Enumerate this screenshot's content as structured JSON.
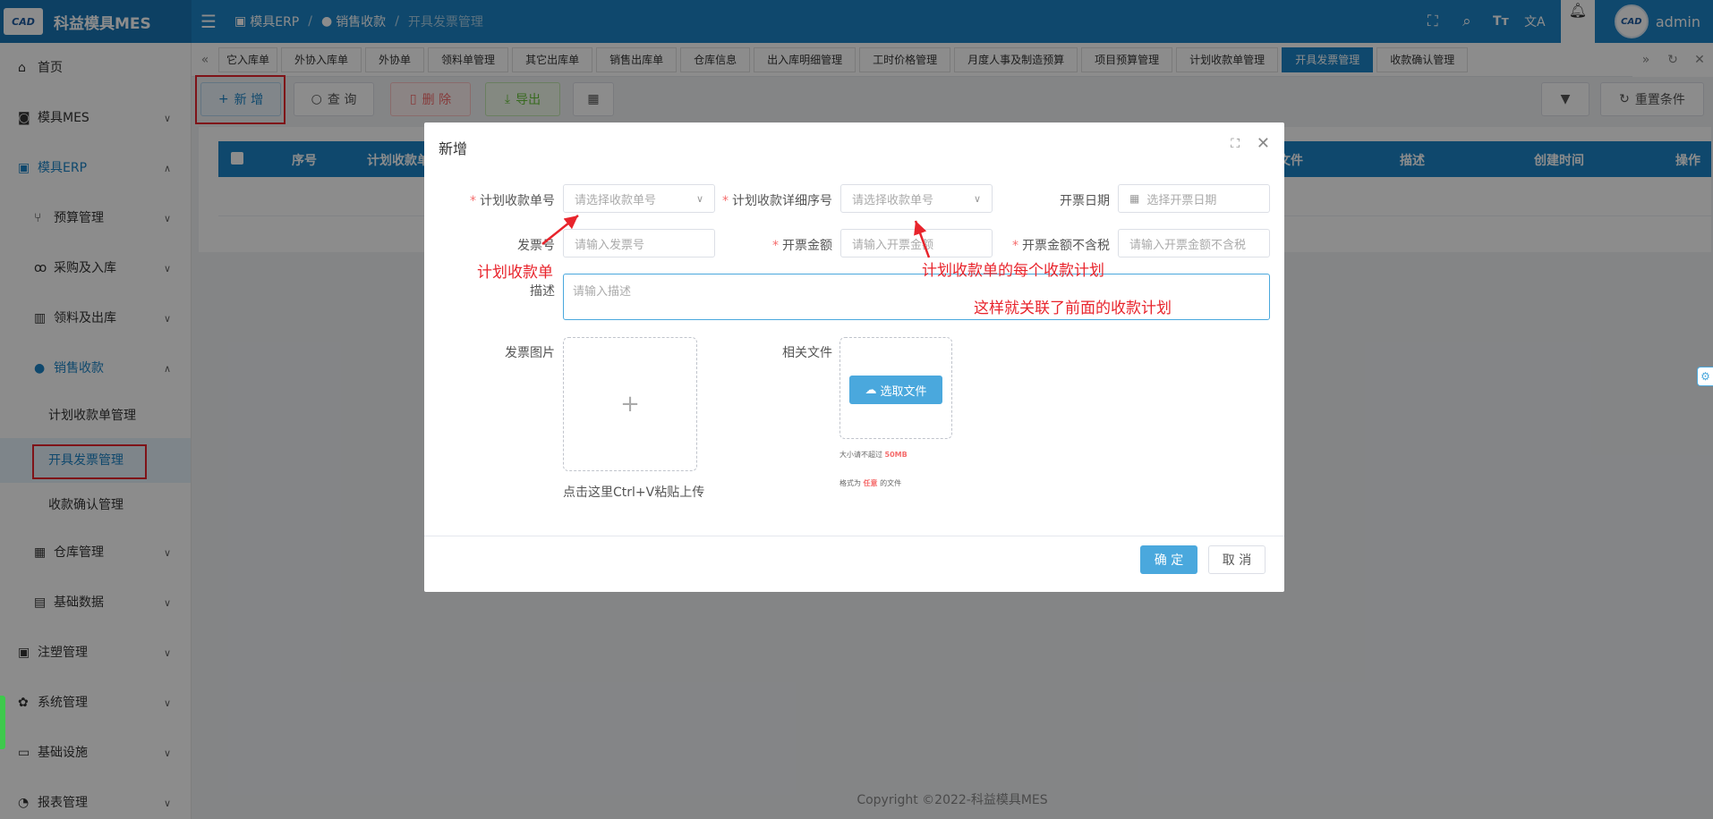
{
  "app": {
    "logo_text": "CAD",
    "title": "科益模具MES"
  },
  "header": {
    "breadcrumb": [
      "模具ERP",
      "销售收款",
      "开具发票管理"
    ],
    "username": "admin"
  },
  "sidebar": {
    "items": [
      {
        "label": "首页"
      },
      {
        "label": "模具MES"
      },
      {
        "label": "模具ERP"
      },
      {
        "label": "预算管理"
      },
      {
        "label": "采购及入库"
      },
      {
        "label": "领料及出库"
      },
      {
        "label": "销售收款"
      },
      {
        "label": "计划收款单管理"
      },
      {
        "label": "开具发票管理"
      },
      {
        "label": "收款确认管理"
      },
      {
        "label": "仓库管理"
      },
      {
        "label": "基础数据"
      },
      {
        "label": "注塑管理"
      },
      {
        "label": "系统管理"
      },
      {
        "label": "基础设施"
      },
      {
        "label": "报表管理"
      }
    ]
  },
  "tabs": [
    "它入库单",
    "外协入库单",
    "外协单",
    "领料单管理",
    "其它出库单",
    "销售出库单",
    "仓库信息",
    "出入库明细管理",
    "工时价格管理",
    "月度人事及制造预算",
    "项目预算管理",
    "计划收款单管理",
    "开具发票管理",
    "收款确认管理"
  ],
  "active_tab": "开具发票管理",
  "toolbar": {
    "add": "新 增",
    "query": "查 询",
    "delete": "删 除",
    "export": "导出",
    "reset": "重置条件"
  },
  "table": {
    "columns": [
      "序号",
      "计划收款单",
      "关文件",
      "描述",
      "创建时间",
      "操作"
    ]
  },
  "dialog": {
    "title": "新增",
    "fields": {
      "plan_no_label": "计划收款单号",
      "plan_no_placeholder": "请选择收款单号",
      "plan_detail_label": "计划收款详细序号",
      "plan_detail_placeholder": "请选择收款单号",
      "date_label": "开票日期",
      "date_placeholder": "选择开票日期",
      "invoice_no_label": "发票号",
      "invoice_no_placeholder": "请输入发票号",
      "amount_label": "开票金额",
      "amount_placeholder": "请输入开票金额",
      "amount_notax_label": "开票金额不含税",
      "amount_notax_placeholder": "请输入开票金额不含税",
      "desc_label": "描述",
      "desc_placeholder": "请输入描述",
      "image_label": "发票图片",
      "file_label": "相关文件",
      "file_button": "选取文件",
      "paste_hint": "点击这里Ctrl+V粘贴上传",
      "size_tip_prefix": "大小请不超过",
      "size_tip_value": "50MB",
      "format_tip_prefix": "格式为",
      "format_tip_value": "任意",
      "format_tip_suffix": "的文件"
    },
    "ok": "确 定",
    "cancel": "取 消"
  },
  "annotations": {
    "a1": "计划收款单",
    "a2": "计划收款单的每个收款计划",
    "a3": "这样就关联了前面的收款计划"
  },
  "footer": {
    "copyright": "Copyright ©2022-科益模具MES"
  },
  "colors": {
    "primary": "#1c84c6",
    "annotation": "#e8242c"
  }
}
